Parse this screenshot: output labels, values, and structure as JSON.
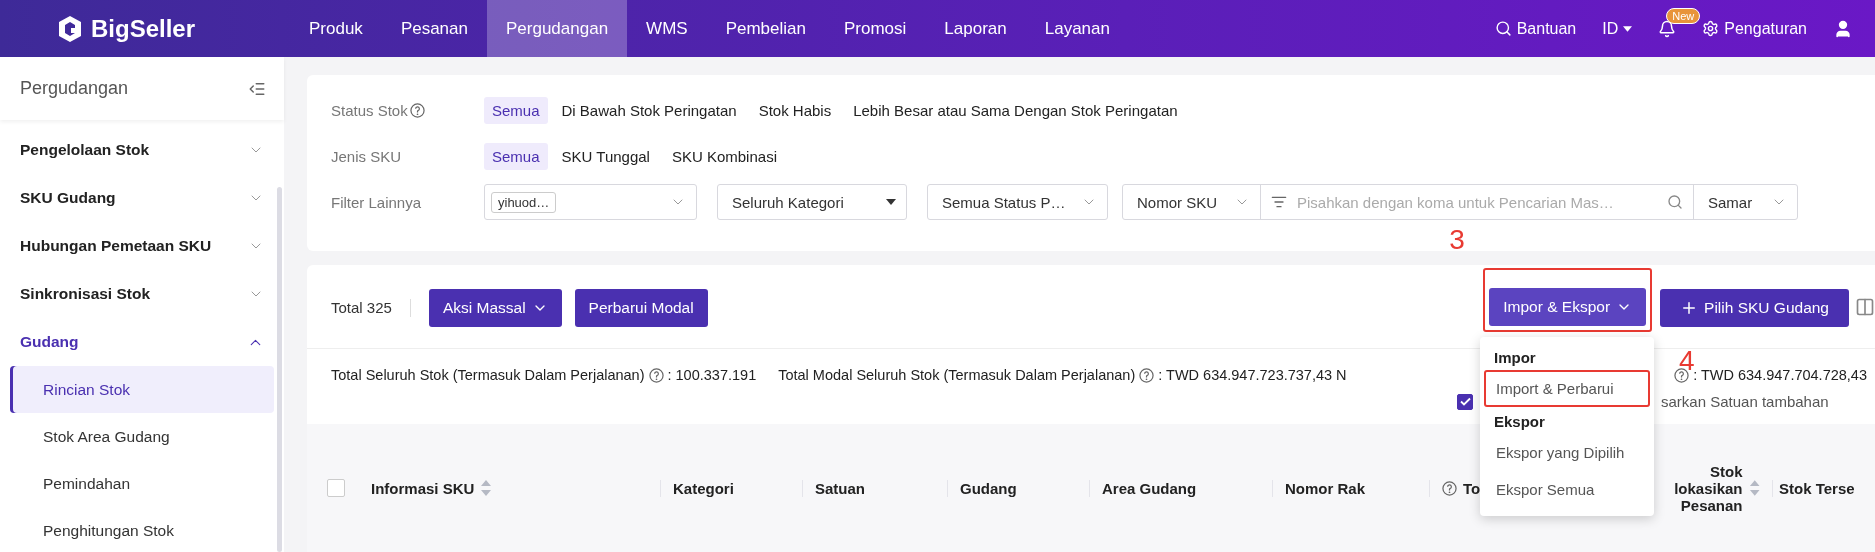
{
  "topbar": {
    "logo": "BigSeller",
    "nav": [
      {
        "label": "Produk",
        "selected": false
      },
      {
        "label": "Pesanan",
        "selected": false
      },
      {
        "label": "Pergudangan",
        "selected": true
      },
      {
        "label": "WMS",
        "selected": false
      },
      {
        "label": "Pembelian",
        "selected": false
      },
      {
        "label": "Promosi",
        "selected": false
      },
      {
        "label": "Laporan",
        "selected": false
      },
      {
        "label": "Layanan",
        "selected": false
      }
    ],
    "help": "Bantuan",
    "language": "ID",
    "notification_badge": "New",
    "settings": "Pengaturan"
  },
  "sidebar": {
    "title": "Pergudangan",
    "items": [
      {
        "label": "Pengelolaan Stok",
        "expanded": false,
        "selected": false
      },
      {
        "label": "SKU Gudang",
        "expanded": false,
        "selected": false
      },
      {
        "label": "Hubungan Pemetaan SKU",
        "expanded": false,
        "selected": false
      },
      {
        "label": "Sinkronisasi Stok",
        "expanded": false,
        "selected": false
      },
      {
        "label": "Gudang",
        "expanded": true,
        "selected": true,
        "children": [
          {
            "label": "Rincian Stok",
            "selected": true
          },
          {
            "label": "Stok Area Gudang",
            "selected": false
          },
          {
            "label": "Pemindahan",
            "selected": false
          },
          {
            "label": "Penghitungan Stok",
            "selected": false
          }
        ]
      }
    ]
  },
  "filters": {
    "status": {
      "label": "Status Stok",
      "options": [
        {
          "label": "Semua",
          "selected": true
        },
        {
          "label": "Di Bawah Stok Peringatan",
          "selected": false
        },
        {
          "label": "Stok Habis",
          "selected": false
        },
        {
          "label": "Lebih Besar atau Sama Dengan Stok Peringatan",
          "selected": false
        }
      ]
    },
    "sku_type": {
      "label": "Jenis SKU",
      "options": [
        {
          "label": "Semua",
          "selected": true
        },
        {
          "label": "SKU Tunggal",
          "selected": false
        },
        {
          "label": "SKU Kombinasi",
          "selected": false
        }
      ]
    },
    "other": {
      "label": "Filter Lainnya",
      "warehouse_tag": "yihuod…",
      "category": "Seluruh Kategori",
      "product_status": "Semua Status P…",
      "search_type": "Nomor SKU",
      "search_placeholder": "Pisahkan dengan koma untuk Pencarian Mas…",
      "match_mode": "Samar"
    }
  },
  "toolbar": {
    "total": "Total 325",
    "left_buttons": [
      {
        "label": "Aksi Massal",
        "caret": true
      },
      {
        "label": "Perbarui Modal",
        "caret": false
      }
    ],
    "import_export": "Impor & Ekspor",
    "add_button": "Pilih SKU Gudang"
  },
  "menu": {
    "groups": [
      {
        "heading": "Impor",
        "items": [
          {
            "label": "Import & Perbarui",
            "highlighted": true
          }
        ]
      },
      {
        "heading": "Ekspor",
        "items": [
          {
            "label": "Ekspor yang Dipilih",
            "highlighted": false
          },
          {
            "label": "Ekspor Semua",
            "highlighted": false
          }
        ]
      }
    ]
  },
  "annotations": [
    "3",
    "4"
  ],
  "stats": [
    {
      "label": "Total Seluruh Stok (Termasuk Dalam Perjalanan)",
      "value": ": 100.337.191"
    },
    {
      "label": "Total Modal Seluruh Stok (Termasuk Dalam Perjalanan)",
      "value": ": TWD 634.947.723.737,43 N"
    },
    {
      "value": ": TWD 634.947.704.728,43"
    }
  ],
  "unit_option": {
    "checked": true,
    "label": "sarkan Satuan tambahan"
  },
  "table": {
    "select_all": false,
    "columns": [
      {
        "label": "Informasi SKU",
        "sortable": true,
        "help": false
      },
      {
        "label": "Kategori",
        "sortable": false,
        "help": false
      },
      {
        "label": "Satuan",
        "sortable": false,
        "help": false
      },
      {
        "label": "Gudang",
        "sortable": false,
        "help": false
      },
      {
        "label": "Area Gudang",
        "sortable": false,
        "help": false
      },
      {
        "label": "Nomor Rak",
        "sortable": false,
        "help": false
      },
      {
        "label": "To",
        "sortable": false,
        "help": true
      },
      {
        "label": "Stok lokasikan Pesanan",
        "sortable": true,
        "help": false
      },
      {
        "label": "Stok Terse",
        "sortable": false,
        "help": false
      }
    ]
  }
}
